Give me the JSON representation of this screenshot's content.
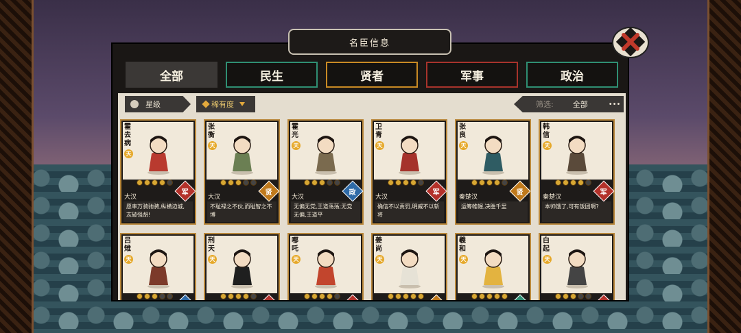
{
  "window": {
    "title": "名臣信息"
  },
  "tabs": [
    {
      "label": "全部",
      "color": "#3b3836"
    },
    {
      "label": "民生",
      "color": "#2f8f73"
    },
    {
      "label": "贤者",
      "color": "#c98a24"
    },
    {
      "label": "军事",
      "color": "#a8332c"
    },
    {
      "label": "政治",
      "color": "#2f8f73"
    }
  ],
  "filters": {
    "star": "星级",
    "rarity": "稀有度",
    "filter_label": "筛选:",
    "filter_value": "全部",
    "more": "•••"
  },
  "cards": [
    {
      "name": "霍去病",
      "rank": "天",
      "stars": [
        1,
        1,
        1,
        1,
        0
      ],
      "dynasty": "大汉",
      "role": "军",
      "role_color": "#b3312a",
      "quote": "愿率万骑驰骋,纵横边城,志破强胡!"
    },
    {
      "name": "张衡",
      "rank": "天",
      "stars": [
        1,
        1,
        1,
        0,
        0
      ],
      "dynasty": "大汉",
      "role": "贤",
      "role_color": "#c07a1c",
      "quote": "不耻禄之不伙,而耻智之不博"
    },
    {
      "name": "霍光",
      "rank": "天",
      "stars": [
        1,
        1,
        1,
        0,
        0
      ],
      "dynasty": "大汉",
      "role": "政",
      "role_color": "#2e6aa7",
      "quote": "无偏无党,王道荡荡;无党无偏,王道平"
    },
    {
      "name": "卫青",
      "rank": "天",
      "stars": [
        1,
        1,
        1,
        1,
        0
      ],
      "dynasty": "大汉",
      "role": "军",
      "role_color": "#b3312a",
      "quote": "确信不以责罚,明威不以斩将"
    },
    {
      "name": "张良",
      "rank": "天",
      "stars": [
        1,
        1,
        1,
        1,
        0
      ],
      "dynasty": "秦楚汉",
      "role": "贤",
      "role_color": "#c07a1c",
      "quote": "运筹帷幄,决胜千里"
    },
    {
      "name": "韩信",
      "rank": "天",
      "stars": [
        1,
        1,
        1,
        1,
        0
      ],
      "dynasty": "秦楚汉",
      "role": "军",
      "role_color": "#b3312a",
      "quote": "本帅饿了,可有饭团啊?"
    },
    {
      "name": "吕雉",
      "rank": "天",
      "stars": [
        1,
        1,
        1,
        0,
        0
      ],
      "dynasty": "",
      "role": "",
      "role_color": "#2e6aa7",
      "quote": ""
    },
    {
      "name": "刑天",
      "rank": "天",
      "stars": [
        1,
        1,
        1,
        1,
        0
      ],
      "dynasty": "",
      "role": "",
      "role_color": "#b3312a",
      "quote": ""
    },
    {
      "name": "哪吒",
      "rank": "天",
      "stars": [
        1,
        1,
        1,
        1,
        0
      ],
      "dynasty": "",
      "role": "",
      "role_color": "#b3312a",
      "quote": ""
    },
    {
      "name": "姜尚",
      "rank": "天",
      "stars": [
        1,
        1,
        1,
        1,
        1
      ],
      "dynasty": "",
      "role": "",
      "role_color": "#c07a1c",
      "quote": ""
    },
    {
      "name": "羲和",
      "rank": "天",
      "stars": [
        1,
        1,
        1,
        1,
        1
      ],
      "dynasty": "",
      "role": "",
      "role_color": "#2f8f73",
      "quote": ""
    },
    {
      "name": "白起",
      "rank": "天",
      "stars": [
        1,
        1,
        1,
        0,
        0
      ],
      "dynasty": "",
      "role": "",
      "role_color": "#b3312a",
      "quote": ""
    }
  ]
}
